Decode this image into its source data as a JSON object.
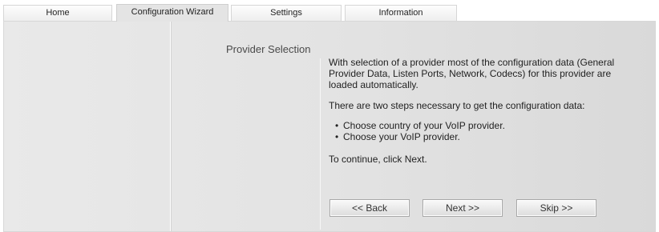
{
  "tabs": {
    "home": "Home",
    "configuration_wizard": "Configuration Wizard",
    "settings": "Settings",
    "information": "Information",
    "active": "Configuration Wizard"
  },
  "section": {
    "title": "Provider Selection"
  },
  "content": {
    "intro": "With selection of a provider most of the configuration data (General Provider Data, Listen Ports, Network, Codecs) for this provider are loaded automatically.",
    "steps_heading": "There are two steps necessary to get the configuration data:",
    "steps": [
      "Choose country of your VoIP provider.",
      "Choose your VoIP provider."
    ],
    "continue_text": "To continue, click Next."
  },
  "buttons": {
    "back": "<< Back",
    "next": "Next >>",
    "skip": "Skip >>"
  },
  "colors": {
    "panel_background": "#e4e4e4",
    "tab_border": "#d6d6d6",
    "button_border": "#a8a8a8"
  }
}
